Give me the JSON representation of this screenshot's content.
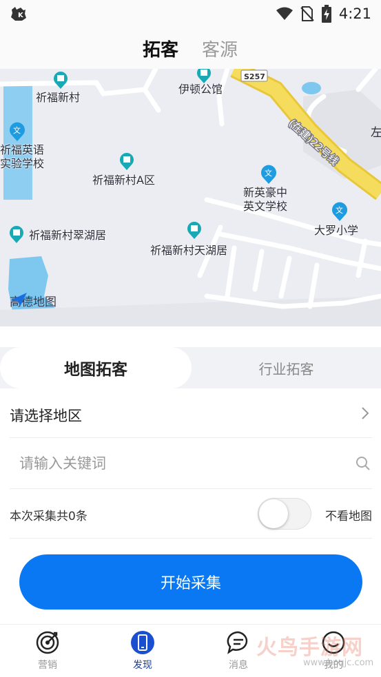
{
  "status_bar": {
    "time": "4:21"
  },
  "header": {
    "tabs": [
      {
        "label": "拓客",
        "active": true
      },
      {
        "label": "客源",
        "active": false
      }
    ]
  },
  "map": {
    "pois": [
      {
        "name": "祈福新村",
        "kind": "residential"
      },
      {
        "name": "伊顿公馆",
        "kind": "residential"
      },
      {
        "name": "祈福英语\n实验学校",
        "kind": "school"
      },
      {
        "name": "祈福新村A区",
        "kind": "residential"
      },
      {
        "name": "新英豪中\n英文学校",
        "kind": "school"
      },
      {
        "name": "大罗小学",
        "kind": "school"
      },
      {
        "name": "祈福新村翠湖居",
        "kind": "residential"
      },
      {
        "name": "祈福新村天湖居",
        "kind": "residential"
      }
    ],
    "road_badge": "S257",
    "road_label": "(在建)22号线",
    "edge_label": "左",
    "provider": "高德地图",
    "colors": {
      "land": "#ecedf3",
      "water": "#7ec8f0",
      "highway": "#f5dc5c",
      "pin_residential": "#19a9b5",
      "pin_school": "#1f9be0"
    }
  },
  "panel": {
    "segment": {
      "active": "地图拓客",
      "inactive": "行业拓客"
    },
    "region_label": "请选择地区",
    "search_placeholder": "请输入关键词",
    "count_text": "本次采集共0条",
    "hide_map_label": "不看地图",
    "hide_map_on": false,
    "start_button": "开始采集",
    "accent_color": "#0a78f2"
  },
  "bottom_nav": {
    "items": [
      {
        "label": "营销",
        "icon": "target-icon",
        "active": false
      },
      {
        "label": "发现",
        "icon": "phone-icon",
        "active": true
      },
      {
        "label": "消息",
        "icon": "chat-icon",
        "active": false
      },
      {
        "label": "我的",
        "icon": "profile-icon",
        "active": false
      }
    ]
  },
  "watermark": {
    "text": "火鸟手游网",
    "url": "www.hnqjc.com"
  }
}
